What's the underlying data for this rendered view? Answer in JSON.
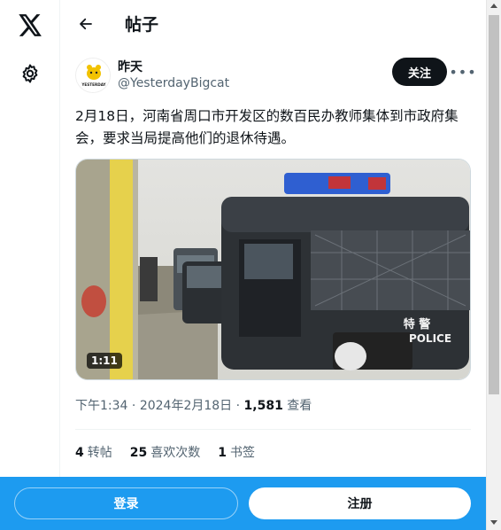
{
  "nav": {
    "logo_icon": "x-logo-icon",
    "settings_icon": "gear-icon"
  },
  "header": {
    "back_icon": "arrow-left-icon",
    "title": "帖子"
  },
  "author": {
    "avatar_text": "YESTERDAY",
    "name": "昨天",
    "handle": "@YesterdayBigcat",
    "follow_label": "关注",
    "more_label": "•••"
  },
  "tweet": {
    "text": "2月18日，河南省周口市开发区的数百民办教师集体到市政府集会，要求当局提高他们的退休待遇。"
  },
  "media": {
    "duration": "1:11",
    "van_plate": "特 警",
    "van_text": "POLICE"
  },
  "meta": {
    "time": "下午1:34",
    "separator": "·",
    "date": "2024年2月18日",
    "views_count": "1,581",
    "views_label": "查看"
  },
  "stats": [
    {
      "count": "4",
      "label": "转帖"
    },
    {
      "count": "25",
      "label": "喜欢次数"
    },
    {
      "count": "1",
      "label": "书签"
    }
  ],
  "bottom_bar": {
    "login_label": "登录",
    "signup_label": "注册"
  },
  "colors": {
    "accent": "#1d9bf0",
    "text": "#0f1419",
    "secondary": "#536471"
  }
}
